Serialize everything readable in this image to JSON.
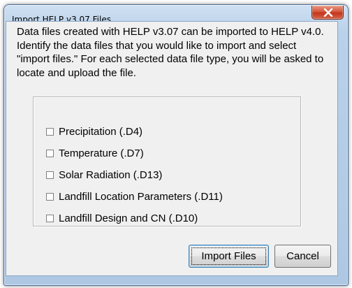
{
  "window": {
    "title": "Import HELP v3.07 Files",
    "close_icon": "close-x-icon",
    "accent": "#c4351c"
  },
  "intro_text": "Data files created with HELP v3.07 can be imported to HELP v4.0. Identify the data files that you would like to import and select \"import files.\" For each selected data file type, you will be asked to locate and upload the file.",
  "options": [
    {
      "label": "Precipitation (.D4)",
      "checked": false
    },
    {
      "label": "Temperature (.D7)",
      "checked": false
    },
    {
      "label": "Solar Radiation (.D13)",
      "checked": false
    },
    {
      "label": "Landfill Location Parameters (.D11)",
      "checked": false
    },
    {
      "label": "Landfill Design and CN (.D10)",
      "checked": false
    }
  ],
  "buttons": {
    "import_label": "Import Files",
    "cancel_label": "Cancel"
  }
}
